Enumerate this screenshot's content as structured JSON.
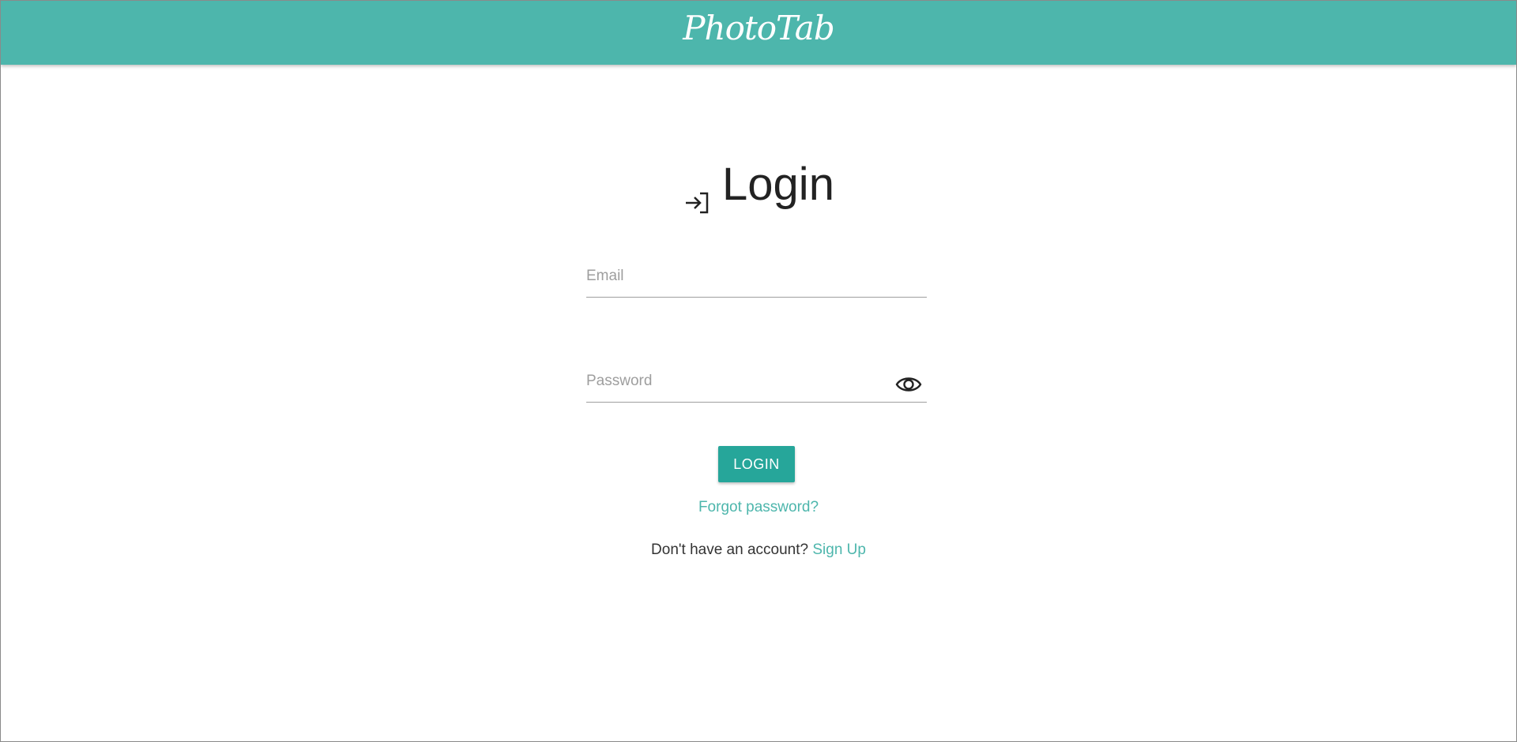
{
  "header": {
    "brand": "PhotoTab",
    "color": "#4db6ac"
  },
  "login": {
    "title": "Login",
    "title_icon": "login-arrow-icon",
    "email_placeholder": "Email",
    "email_value": "",
    "password_placeholder": "Password",
    "password_value": "",
    "password_toggle_icon": "eye-icon",
    "submit_label": "LOGIN",
    "submit_color": "#26a69a",
    "forgot_label": "Forgot password?",
    "signup_prompt": "Don't have an account?",
    "signup_label": "Sign Up",
    "link_color": "#4db6ac"
  }
}
